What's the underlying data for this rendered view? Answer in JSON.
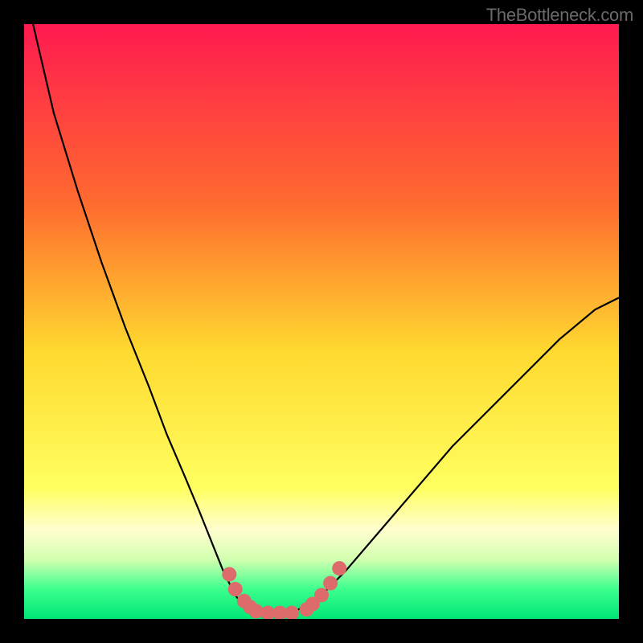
{
  "watermark": "TheBottleneck.com",
  "chart_data": {
    "type": "line",
    "title": "",
    "xlabel": "",
    "ylabel": "",
    "xlim": [
      0,
      100
    ],
    "ylim": [
      0,
      100
    ],
    "grid": false,
    "gradient": {
      "stops": [
        {
          "offset": 0,
          "color": "#ff1a50"
        },
        {
          "offset": 30,
          "color": "#ff6a2f"
        },
        {
          "offset": 55,
          "color": "#ffd92f"
        },
        {
          "offset": 78,
          "color": "#ffff60"
        },
        {
          "offset": 85,
          "color": "#fffecf"
        },
        {
          "offset": 90,
          "color": "#d3ffb0"
        },
        {
          "offset": 95,
          "color": "#3cff8d"
        },
        {
          "offset": 100,
          "color": "#00e676"
        }
      ]
    },
    "series": [
      {
        "name": "curve",
        "x": [
          1.5,
          5,
          9,
          13,
          17,
          21,
          24,
          27,
          29.5,
          31.5,
          33.5,
          35.5,
          37,
          38.5,
          40,
          42,
          46,
          50,
          54,
          60,
          66,
          72,
          78,
          84,
          90,
          96,
          100
        ],
        "values": [
          100,
          85,
          72,
          60,
          49,
          39,
          31,
          24,
          18,
          13,
          8,
          4,
          2,
          1,
          1,
          1,
          1.5,
          4,
          8,
          15,
          22,
          29,
          35,
          41,
          47,
          52,
          54
        ]
      }
    ],
    "markers": {
      "name": "dots",
      "color": "#dd6b6b",
      "x": [
        34.5,
        35.5,
        37,
        38,
        39,
        41,
        43,
        45,
        47.5,
        48.5,
        50,
        51.5,
        53
      ],
      "values": [
        7.5,
        5,
        3,
        2,
        1.3,
        1,
        1,
        1,
        1.6,
        2.5,
        4,
        6,
        8.5
      ]
    }
  }
}
